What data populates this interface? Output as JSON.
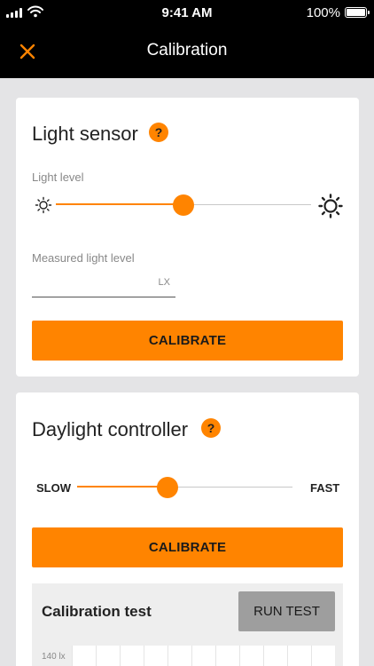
{
  "status_bar": {
    "time": "9:41 AM",
    "battery": "100%"
  },
  "nav": {
    "title": "Calibration",
    "close_icon": "close-icon"
  },
  "colors": {
    "accent": "#ff8400",
    "nav_bg": "#000000",
    "page_bg": "#e4e4e6",
    "secondary_button": "#9e9e9e"
  },
  "light_sensor": {
    "title": "Light sensor",
    "help": "?",
    "slider_label": "Light level",
    "slider_value": 0.5,
    "low_icon": "sun-small-icon",
    "high_icon": "sun-large-icon",
    "measured_label": "Measured light level",
    "measured_value": "",
    "measured_unit": "LX",
    "calibrate_label": "CALIBRATE"
  },
  "daylight_controller": {
    "title": "Daylight controller",
    "help": "?",
    "slow_label": "SLOW",
    "fast_label": "FAST",
    "slider_value": 0.42,
    "calibrate_label": "CALIBRATE",
    "test": {
      "title": "Calibration test",
      "run_label": "RUN TEST",
      "y_top_label": "140 lx"
    }
  }
}
